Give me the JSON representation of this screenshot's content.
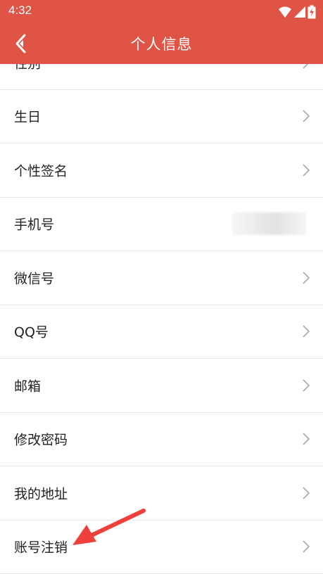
{
  "status_bar": {
    "time": "4:32",
    "icons": [
      "wifi-icon",
      "signal-icon",
      "battery-charging-icon"
    ]
  },
  "header": {
    "title": "个人信息",
    "back_icon": "chevron-left-icon",
    "background_color": "#df5444"
  },
  "rows": [
    {
      "label": "性别",
      "has_chevron": true
    },
    {
      "label": "生日",
      "has_chevron": true
    },
    {
      "label": "个性签名",
      "has_chevron": true
    },
    {
      "label": "手机号",
      "has_chevron": false,
      "value_obscured": true
    },
    {
      "label": "微信号",
      "has_chevron": true
    },
    {
      "label": "QQ号",
      "has_chevron": true
    },
    {
      "label": "邮箱",
      "has_chevron": true
    },
    {
      "label": "修改密码",
      "has_chevron": true
    },
    {
      "label": "我的地址",
      "has_chevron": true
    },
    {
      "label": "账号注销",
      "has_chevron": true
    }
  ],
  "annotation": {
    "type": "arrow",
    "color": "#f0403c",
    "points_to": "账号注销"
  }
}
